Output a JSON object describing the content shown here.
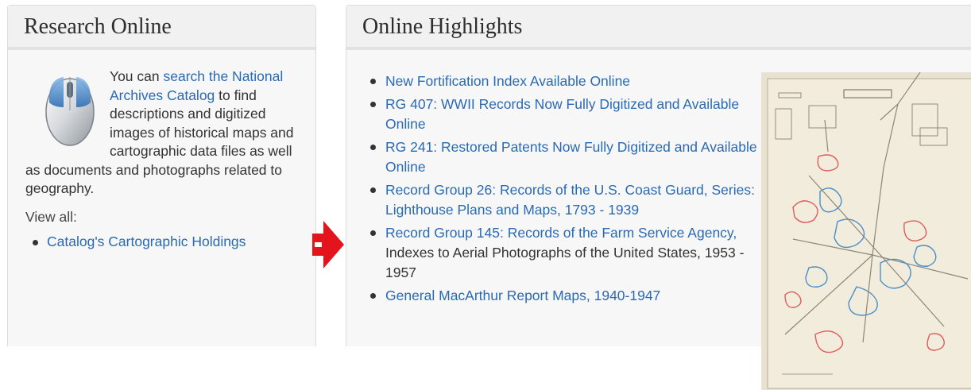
{
  "left_panel": {
    "title": "Research Online",
    "intro_prefix": "You can ",
    "intro_link": "search the National Archives Catalog",
    "intro_suffix": " to find descriptions and digitized images of historical maps and cartographic data files as well as documents and photographs related to geography.",
    "view_all_label": "View all:",
    "links": [
      "Catalog's Cartographic Holdings"
    ],
    "icon": "computer-mouse-icon"
  },
  "right_panel": {
    "title": "Online Highlights",
    "items": [
      {
        "link": "New Fortification Index Available Online",
        "extra": ""
      },
      {
        "link": "RG 407: WWII Records Now Fully Digitized and Available Online",
        "extra": ""
      },
      {
        "link": "RG 241: Restored Patents Now Fully Digitized and Available Online",
        "extra": ""
      },
      {
        "link": "Record Group 26: Records of the U.S. Coast Guard, Series: Lighthouse Plans and Maps, 1793 - 1939",
        "extra": ""
      },
      {
        "link": "Record Group 145: Records of the Farm Service Agency,",
        "extra": " Indexes to Aerial Photographs of the United States, 1953 - 1957"
      },
      {
        "link": "General MacArthur Report Maps, 1940-1947",
        "extra": ""
      }
    ],
    "image_icon": "historical-map-image"
  },
  "colors": {
    "link": "#2a6ab4",
    "arrow": "#e3141b",
    "panel_bg": "#f7f7f7",
    "header_bg": "#f1f1f1"
  },
  "arrow_icon": "right-arrow-icon"
}
